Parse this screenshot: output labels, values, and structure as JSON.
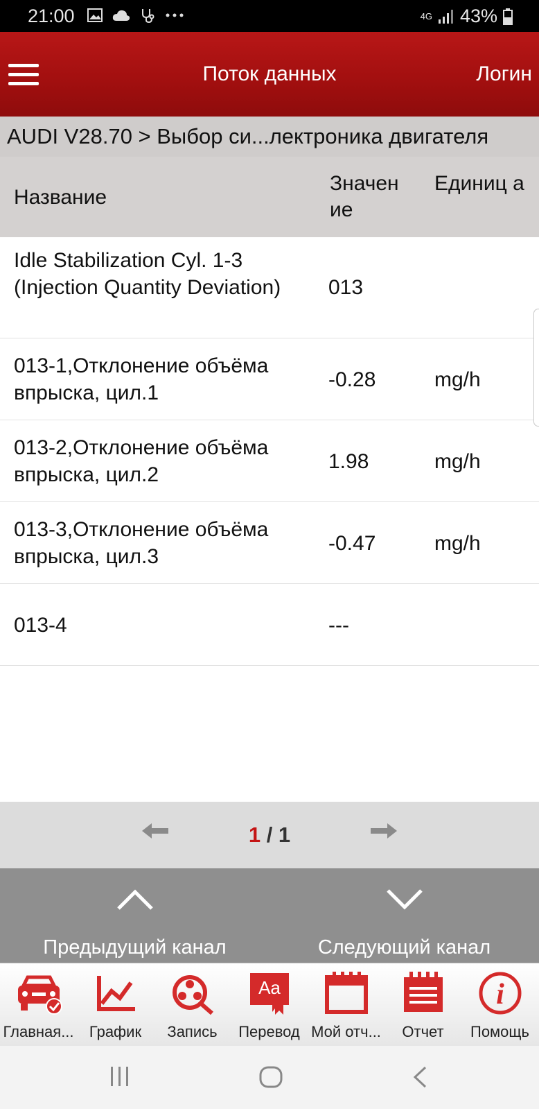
{
  "status_bar": {
    "time": "21:00",
    "network": "4G",
    "battery": "43%",
    "icons": [
      "image-icon",
      "cloud-icon",
      "stethoscope-icon",
      "more-icon"
    ]
  },
  "app_bar": {
    "title": "Поток данных",
    "login_label": "Логин"
  },
  "breadcrumb": "AUDI V28.70 > Выбор си...лектроника двигателя",
  "table": {
    "headers": {
      "name": "Название",
      "value": "Значен ие",
      "unit": "Единиц а"
    },
    "rows": [
      {
        "name": "Idle Stabilization Cyl. 1-3 (Injection Quantity Deviation)",
        "value": "013",
        "unit": ""
      },
      {
        "name": "013-1,Отклонение объёма впрыска, цил.1",
        "value": "-0.28",
        "unit": "mg/h"
      },
      {
        "name": "013-2,Отклонение объёма впрыска, цил.2",
        "value": "1.98",
        "unit": "mg/h"
      },
      {
        "name": "013-3,Отклонение объёма впрыска, цил.3",
        "value": "-0.47",
        "unit": "mg/h"
      },
      {
        "name": "013-4",
        "value": "---",
        "unit": ""
      }
    ]
  },
  "pager": {
    "current": "1",
    "total": "/ 1"
  },
  "channels": {
    "prev_label": "Предыдущий канал",
    "next_label": "Следующий канал"
  },
  "toolbar": {
    "items": [
      {
        "label": "Главная...",
        "icon": "car-home-icon"
      },
      {
        "label": "График",
        "icon": "graph-icon"
      },
      {
        "label": "Запись",
        "icon": "record-icon"
      },
      {
        "label": "Перевод",
        "icon": "translate-icon"
      },
      {
        "label": "Мой отч...",
        "icon": "my-report-icon"
      },
      {
        "label": "Отчет",
        "icon": "report-icon"
      },
      {
        "label": "Помощь",
        "icon": "help-icon"
      }
    ]
  },
  "colors": {
    "accent": "#a81212",
    "icon_red": "#d42a2a",
    "page_current": "#c41414"
  }
}
